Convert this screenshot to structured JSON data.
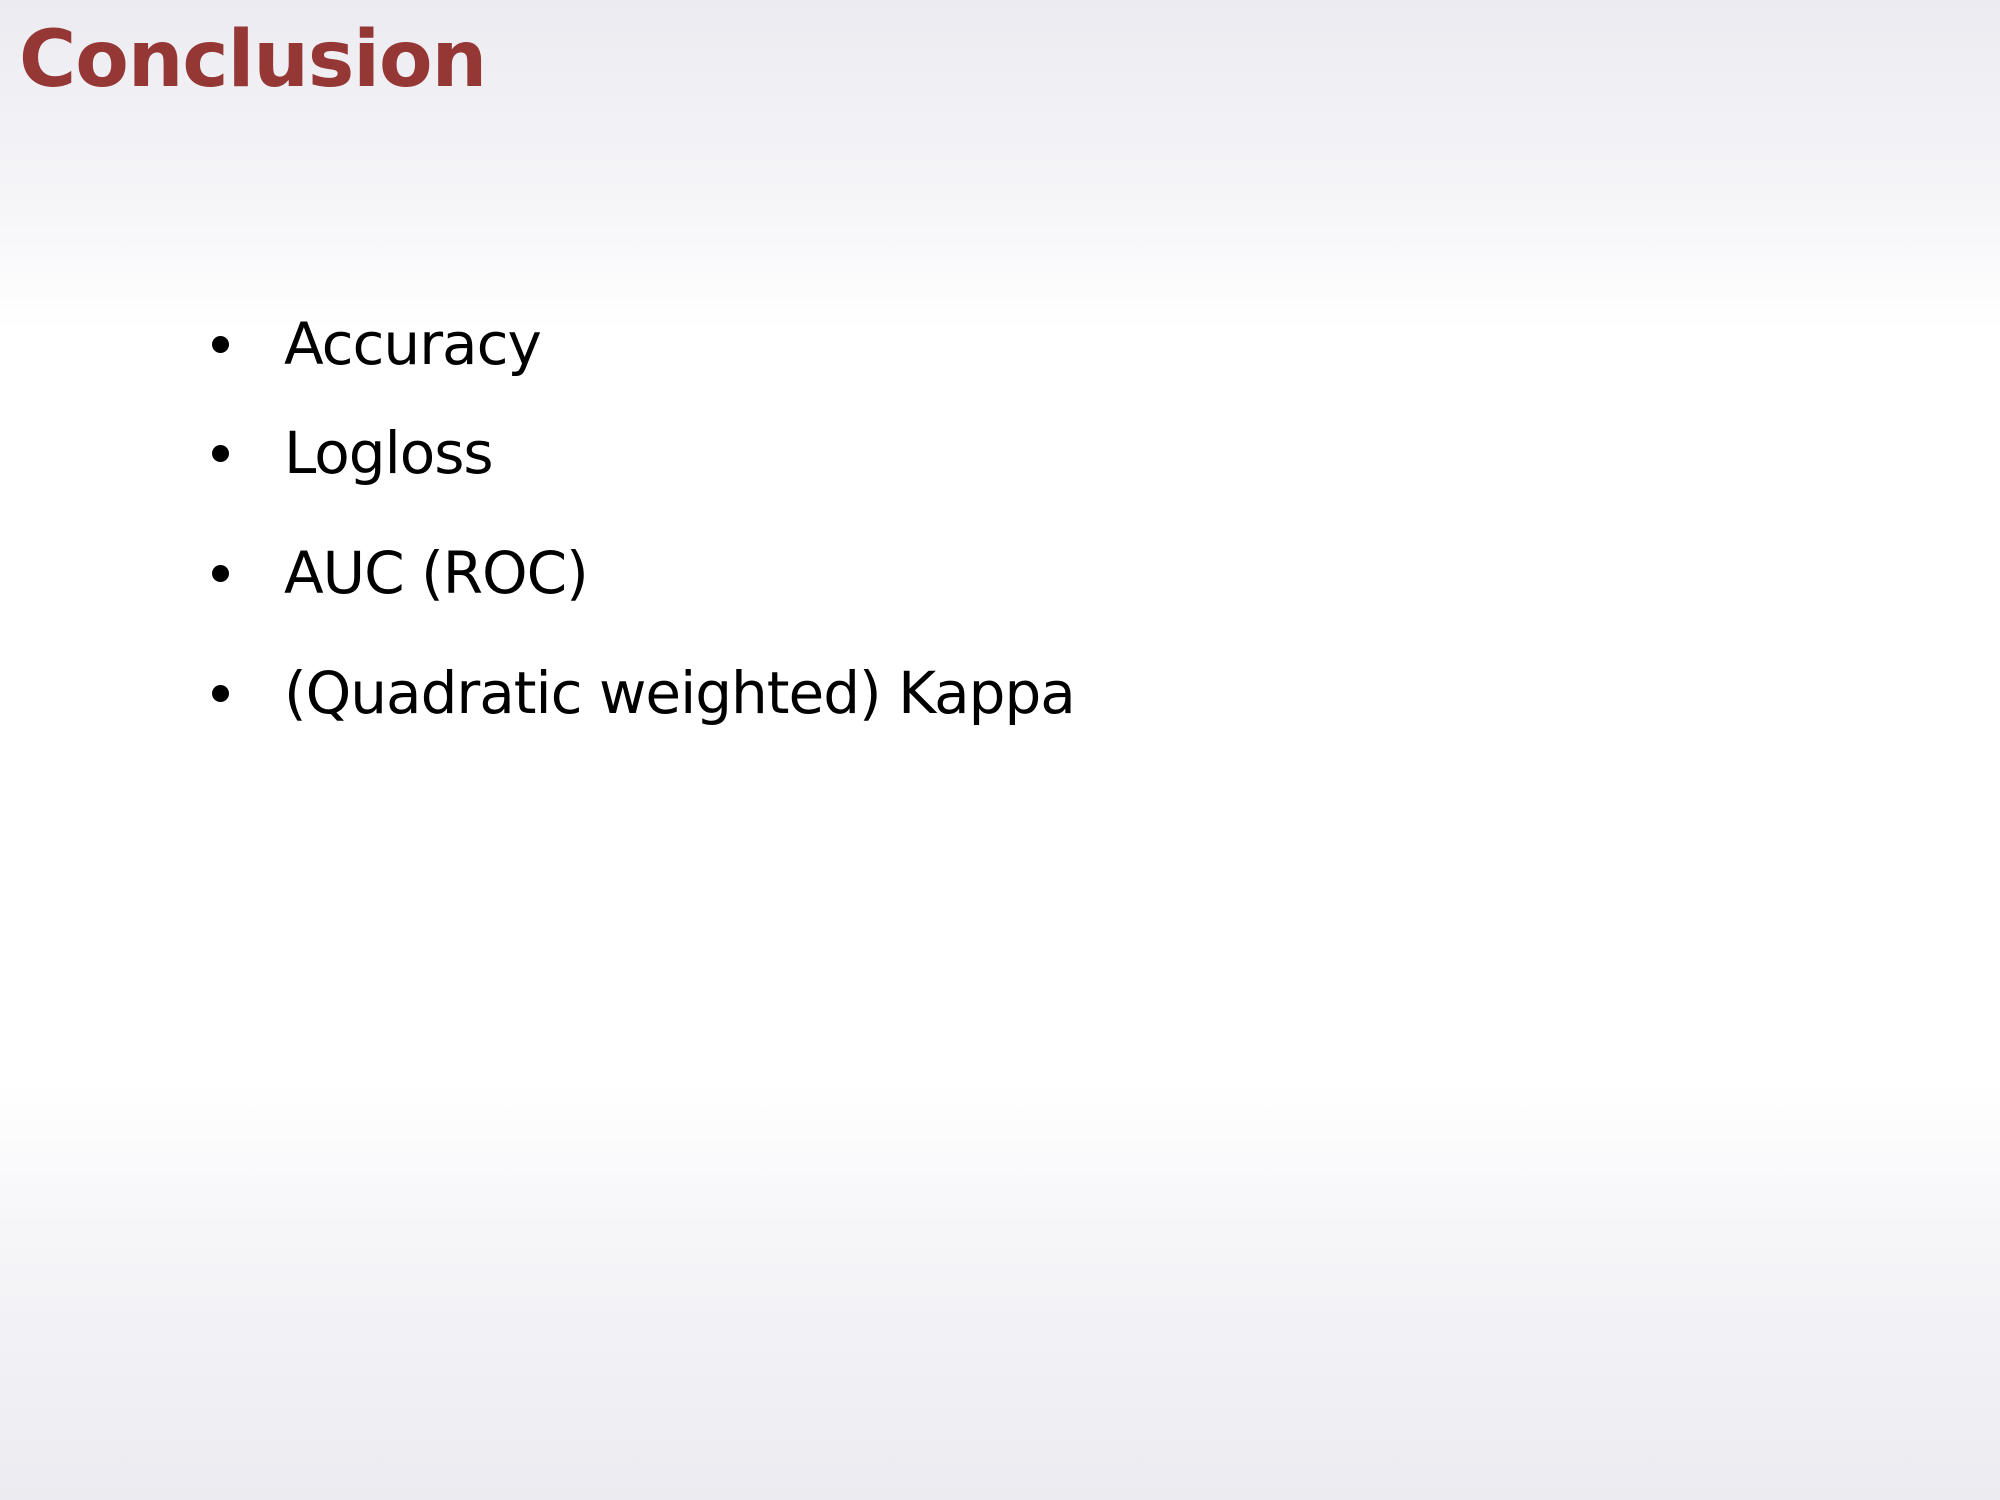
{
  "slide": {
    "title": "Conclusion",
    "title_color": "#953735",
    "bullets": [
      "Accuracy",
      "Logloss",
      "AUC (ROC)",
      "(Quadratic weighted) Kappa"
    ]
  }
}
